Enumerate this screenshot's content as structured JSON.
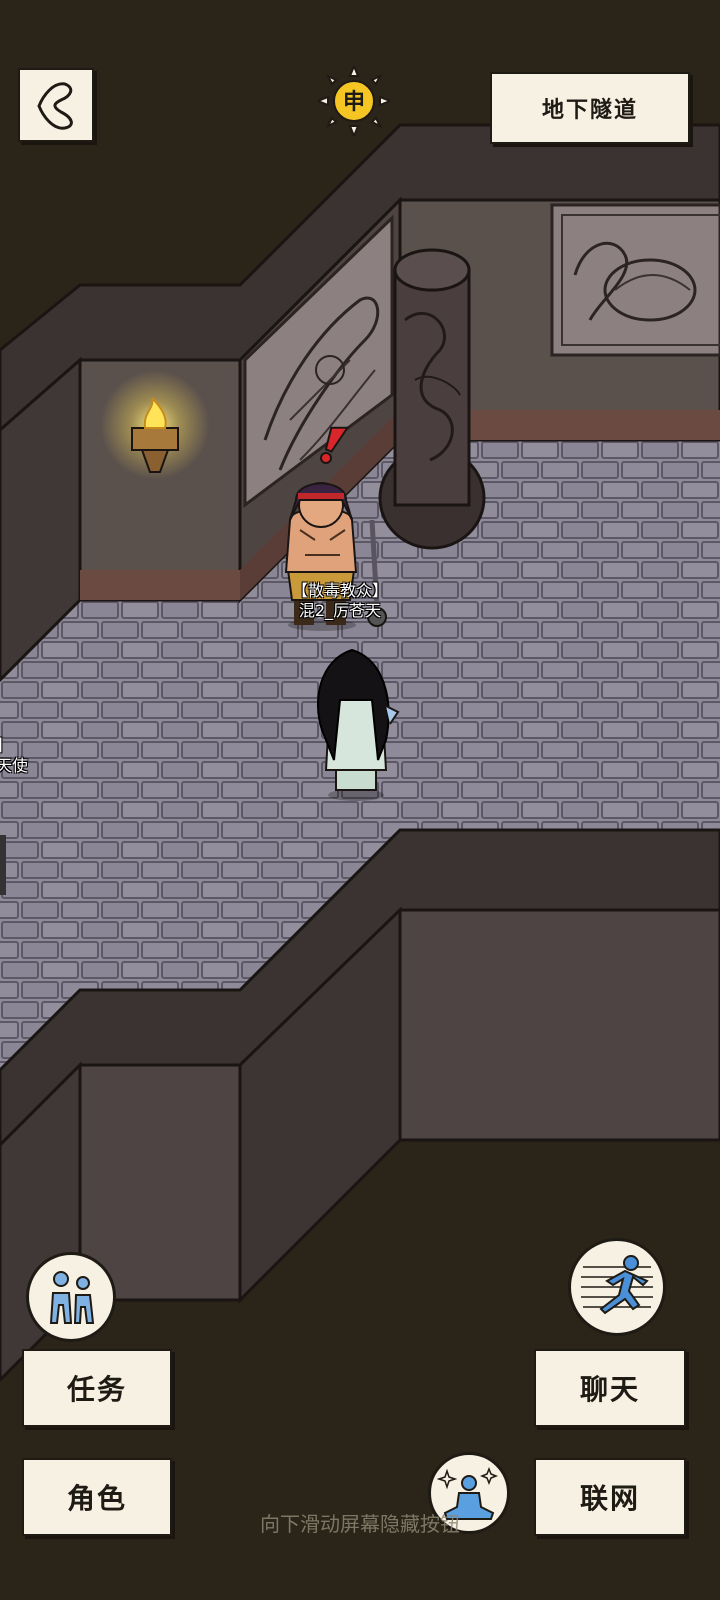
{
  "top": {
    "back_icon": "back-chevron-icon",
    "time_badge": "申",
    "location": "地下隧道"
  },
  "npcs": [
    {
      "faction": "【散毒教众】",
      "name": "混2_厉苍天",
      "alert": "!"
    },
    {
      "faction": "】",
      "name": "天使"
    }
  ],
  "left_buttons": {
    "quest": "任务",
    "character": "角色"
  },
  "right_buttons": {
    "chat": "聊天",
    "network": "联网"
  },
  "icons": {
    "party": "party-icon",
    "run": "run-icon",
    "meditate": "meditate-icon"
  },
  "hint": "向下滑动屏幕隐藏按钮",
  "colors": {
    "floor": "#8a8694",
    "wall": "#4a4240",
    "void": "#2b2418",
    "paper": "#f6f1e3"
  }
}
